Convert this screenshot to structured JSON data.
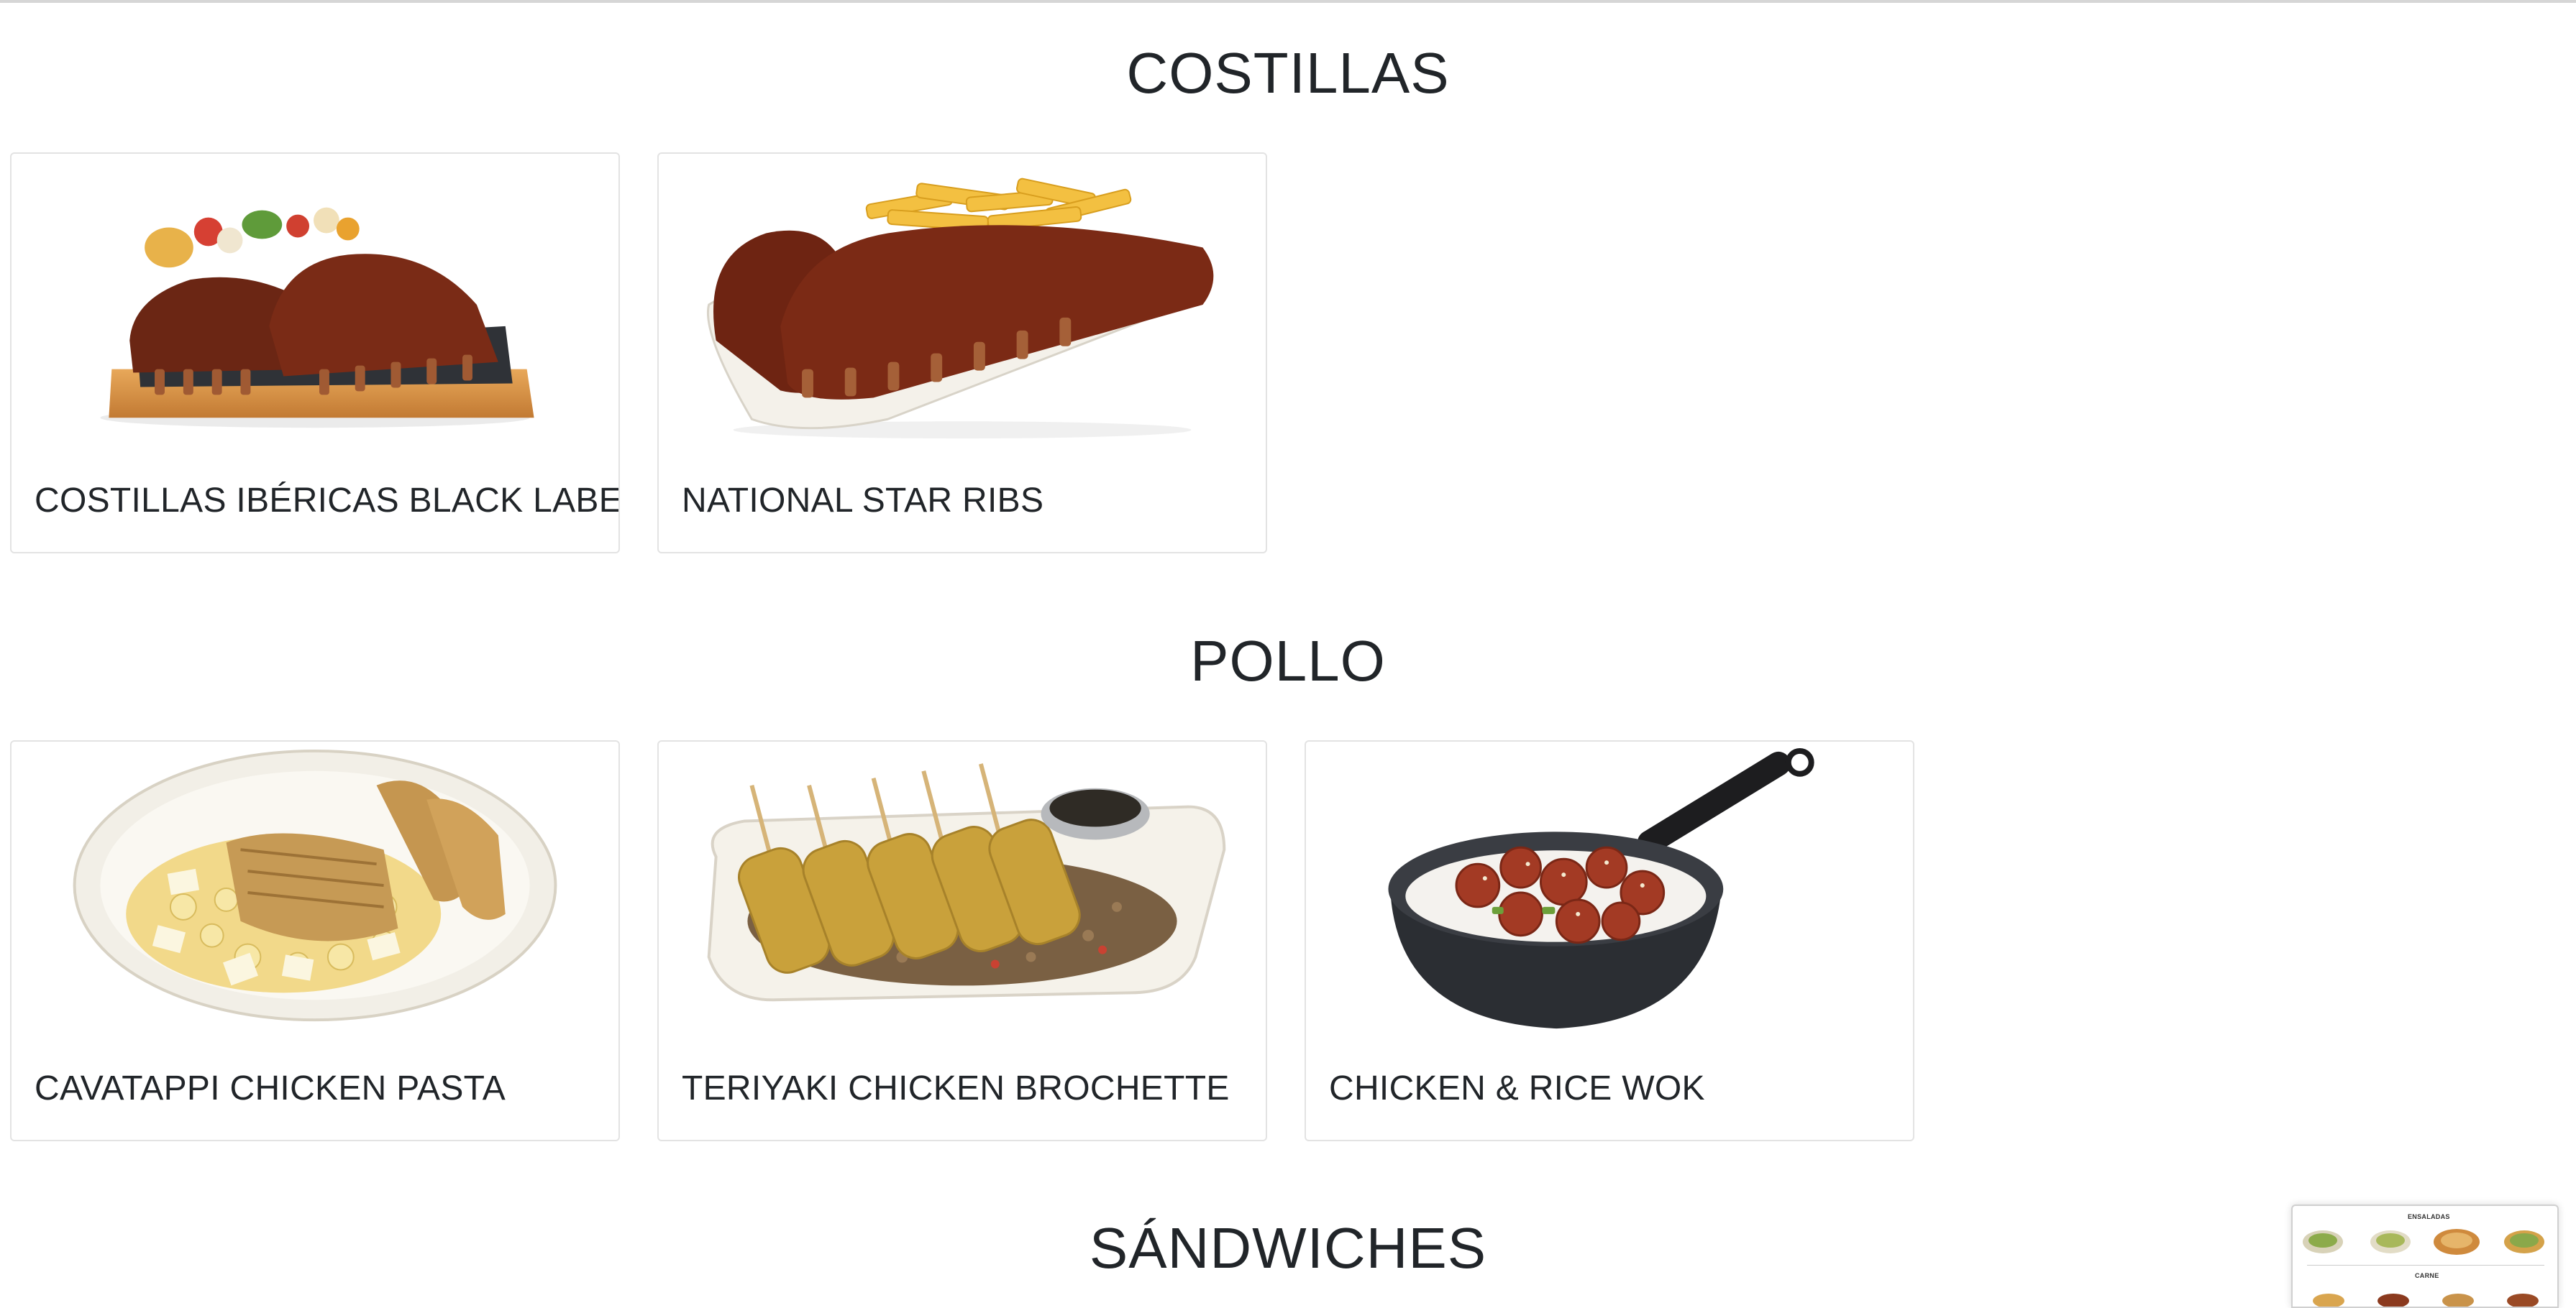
{
  "sections": [
    {
      "title": "COSTILLAS",
      "items": [
        {
          "name": "COSTILLAS IBÉRICAS BLACK LABEL",
          "image": "ribs-on-board-image"
        },
        {
          "name": "NATIONAL STAR RIBS",
          "image": "ribs-with-fries-image"
        }
      ]
    },
    {
      "title": "POLLO",
      "items": [
        {
          "name": "CAVATAPPI CHICKEN PASTA",
          "image": "chicken-pasta-image"
        },
        {
          "name": "TERIYAKI CHICKEN BROCHETTE",
          "image": "chicken-skewers-image"
        },
        {
          "name": "CHICKEN & RICE WOK",
          "image": "chicken-wok-image"
        }
      ]
    },
    {
      "title": "SÁNDWICHES",
      "items": []
    }
  ],
  "preview": {
    "heading": "ENSALADAS",
    "subheading": "CARNE"
  },
  "colors": {
    "text": "#212529",
    "card_border": "#e3e3e3",
    "background": "#ffffff"
  }
}
